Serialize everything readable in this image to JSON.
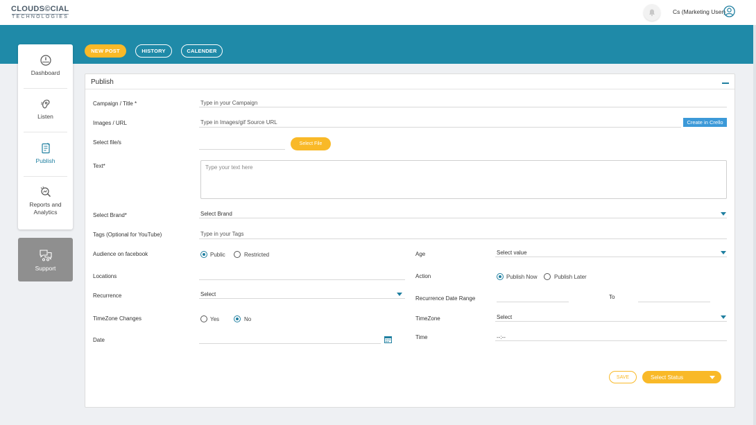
{
  "header": {
    "logo_line1": "CLOUDS©CIAL",
    "logo_line2": "TECHNOLOGIES",
    "user_name": "Cs (Marketing User)"
  },
  "toolbar": {
    "new_post": "NEW POST",
    "history": "HISTORY",
    "calender": "CALENDER"
  },
  "sidebar": {
    "items": [
      {
        "label": "Dashboard",
        "icon": "speedometer-icon"
      },
      {
        "label": "Listen",
        "icon": "ear-icon"
      },
      {
        "label": "Publish",
        "icon": "publish-doc-icon"
      },
      {
        "label": "Reports and Analytics",
        "icon": "magnifier-chart-icon"
      }
    ],
    "active": "Publish",
    "support_label": "Support"
  },
  "panel": {
    "title": "Publish",
    "fields": {
      "campaign_label": "Campaign / Title *",
      "campaign_placeholder": "Type in your Campaign",
      "images_label": "Images / URL",
      "images_placeholder": "Type in Images/gif Source URL",
      "create_crello": "Create in Crello",
      "select_files_label": "Select file/s",
      "select_file_button": "Select File",
      "text_label": "Text*",
      "text_placeholder": "Type your text here",
      "brand_label": "Select Brand*",
      "brand_value": "Select Brand",
      "tags_label": "Tags (Optional for YouTube)",
      "tags_placeholder": "Type in your Tags",
      "audience_label": "Audience on facebook",
      "audience_public": "Public",
      "audience_restricted": "Restricted",
      "audience_selected": "Public",
      "age_label": "Age",
      "age_value": "Select value",
      "locations_label": "Locations",
      "action_label": "Action",
      "action_publish_now": "Publish Now",
      "action_publish_later": "Publish Later",
      "action_selected": "Publish Now",
      "recurrence_label": "Recurrence",
      "recurrence_value": "Select",
      "recurrence_range_label": "Recurrence Date Range",
      "to_label": "To",
      "timezone_changes_label": "TimeZone Changes",
      "tz_yes": "Yes",
      "tz_no": "No",
      "tz_selected": "No",
      "timezone_label": "TimeZone",
      "timezone_value": "Select",
      "date_label": "Date",
      "time_label": "Time",
      "time_value": "--:--"
    },
    "save_button": "SAVE",
    "status_button": "Select Status"
  },
  "colors": {
    "teal": "#1f8aa8",
    "accent_yellow": "#f9b928",
    "link_blue": "#3c99d8"
  }
}
